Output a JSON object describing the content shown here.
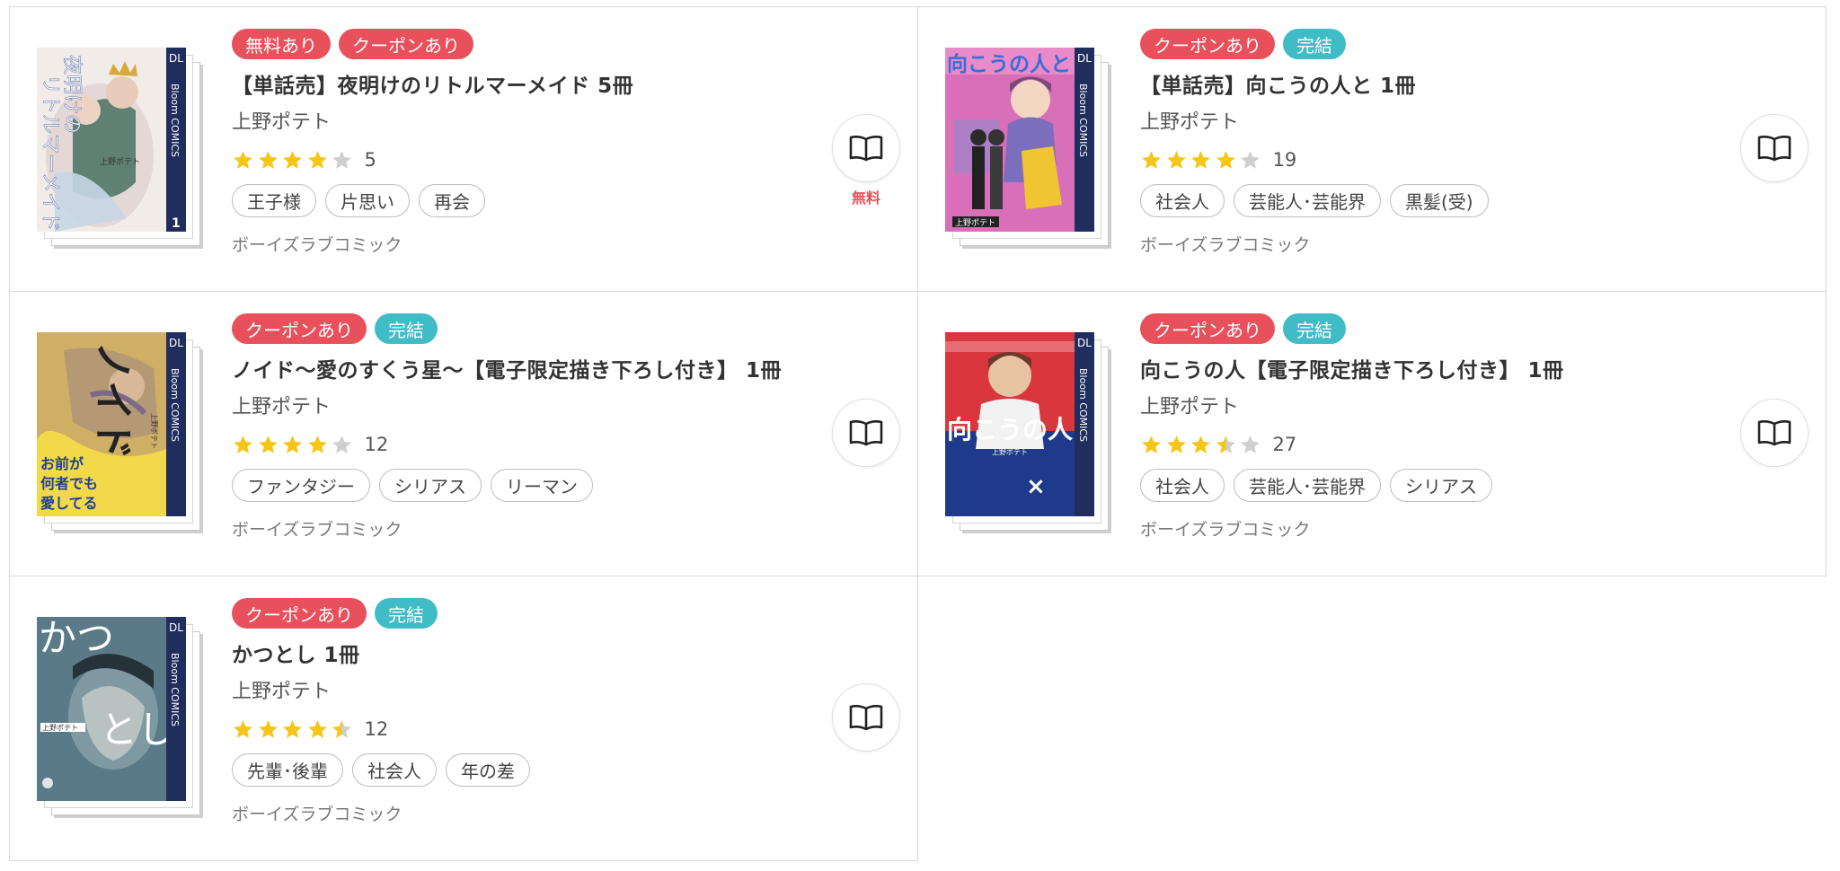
{
  "colors": {
    "badge_red": "#e8505b",
    "badge_teal": "#3fbcc6",
    "star_on": "#f5c518",
    "star_off": "#cfcfcf"
  },
  "items": [
    {
      "badges": [
        {
          "label": "無料あり",
          "color": "red"
        },
        {
          "label": "クーポンあり",
          "color": "red"
        }
      ],
      "title": "【単話売】夜明けのリトルマーメイド 5冊",
      "author": "上野ポテト",
      "rating": 4,
      "rating_count": "5",
      "tags": [
        "王子様",
        "片思い",
        "再会"
      ],
      "publisher": "ボーイズラブコミック",
      "read_icon": "book-icon",
      "free_label": "無料",
      "cover_text": [
        "夜明けの",
        "リトルマーメイド"
      ],
      "cover_spine": "Bloom COMICS",
      "cover_logo": "DL",
      "cover_author": "上野ポテト",
      "cover_volume": "1"
    },
    {
      "badges": [
        {
          "label": "クーポンあり",
          "color": "red"
        },
        {
          "label": "完結",
          "color": "teal"
        }
      ],
      "title": "【単話売】向こうの人と 1冊",
      "author": "上野ポテト",
      "rating": 4,
      "rating_count": "19",
      "tags": [
        "社会人",
        "芸能人･芸能界",
        "黒髪(受)"
      ],
      "publisher": "ボーイズラブコミック",
      "read_icon": "book-icon",
      "cover_text": [
        "向こうの人と"
      ],
      "cover_spine": "Bloom COMICS",
      "cover_logo": "DL",
      "cover_author": "上野ポテト"
    },
    {
      "badges": [
        {
          "label": "クーポンあり",
          "color": "red"
        },
        {
          "label": "完結",
          "color": "teal"
        }
      ],
      "title": "ノイド〜愛のすくう星〜【電子限定描き下ろし付き】 1冊",
      "author": "上野ポテト",
      "rating": 4,
      "rating_count": "12",
      "tags": [
        "ファンタジー",
        "シリアス",
        "リーマン"
      ],
      "publisher": "ボーイズラブコミック",
      "read_icon": "book-icon",
      "cover_text": [
        "ノイド",
        "お前が",
        "何者でも",
        "愛してる"
      ],
      "cover_spine": "Bloom COMICS",
      "cover_logo": "DL",
      "cover_author": "上野ポテト"
    },
    {
      "badges": [
        {
          "label": "クーポンあり",
          "color": "red"
        },
        {
          "label": "完結",
          "color": "teal"
        }
      ],
      "title": "向こうの人【電子限定描き下ろし付き】 1冊",
      "author": "上野ポテト",
      "rating": 3.5,
      "rating_count": "27",
      "tags": [
        "社会人",
        "芸能人･芸能界",
        "シリアス"
      ],
      "publisher": "ボーイズラブコミック",
      "read_icon": "book-icon",
      "cover_text": [
        "向こうの人"
      ],
      "cover_spine": "Bloom COMICS",
      "cover_logo": "DL",
      "cover_author": "上野ポテト"
    },
    {
      "badges": [
        {
          "label": "クーポンあり",
          "color": "red"
        },
        {
          "label": "完結",
          "color": "teal"
        }
      ],
      "title": "かつとし 1冊",
      "author": "上野ポテト",
      "rating": 4.5,
      "rating_count": "12",
      "tags": [
        "先輩･後輩",
        "社会人",
        "年の差"
      ],
      "publisher": "ボーイズラブコミック",
      "read_icon": "book-icon",
      "cover_text": [
        "かつ",
        "とし"
      ],
      "cover_spine": "Bloom COMICS",
      "cover_logo": "DL",
      "cover_author": "上野ポテト"
    }
  ]
}
